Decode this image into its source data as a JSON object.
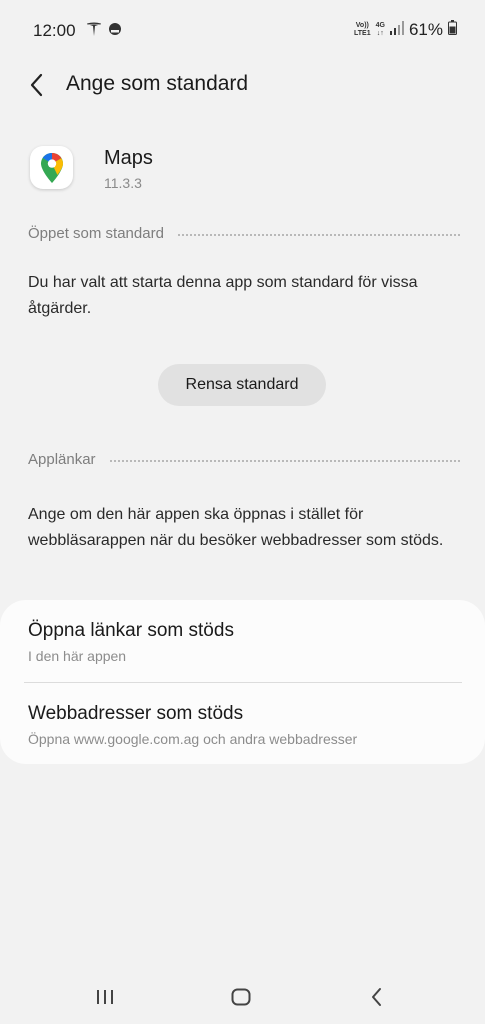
{
  "status_bar": {
    "time": "12:00",
    "network_top": "Vo))",
    "network_bottom": "LTE1",
    "data_type_top": "4G",
    "data_type_bottom": "↓↑",
    "battery_percent": "61%"
  },
  "header": {
    "title": "Ange som standard",
    "back_icon": "chevron-left-icon"
  },
  "app": {
    "name": "Maps",
    "version": "11.3.3",
    "icon": "google-maps-pin-icon"
  },
  "open_by_default": {
    "section_label": "Öppet som standard",
    "description": "Du har valt att starta denna app som standard för vissa åtgärder.",
    "clear_button_label": "Rensa standard"
  },
  "app_links": {
    "section_label": "Applänkar",
    "description": "Ange om den här appen ska öppnas i stället för webbläsarappen när du besöker webbadresser som stöds.",
    "items": [
      {
        "title": "Öppna länkar som stöds",
        "subtitle": "I den här appen"
      },
      {
        "title": "Webbadresser som stöds",
        "subtitle": "Öppna www.google.com.ag och andra webbadresser"
      }
    ]
  },
  "nav_bar": {
    "recents_icon": "recents-icon",
    "home_icon": "home-icon",
    "back_icon": "back-icon"
  },
  "colors": {
    "background": "#f2f2f2",
    "card": "#fcfcfc",
    "button": "#e1e1e1",
    "section_label": "#7e7e7e"
  }
}
